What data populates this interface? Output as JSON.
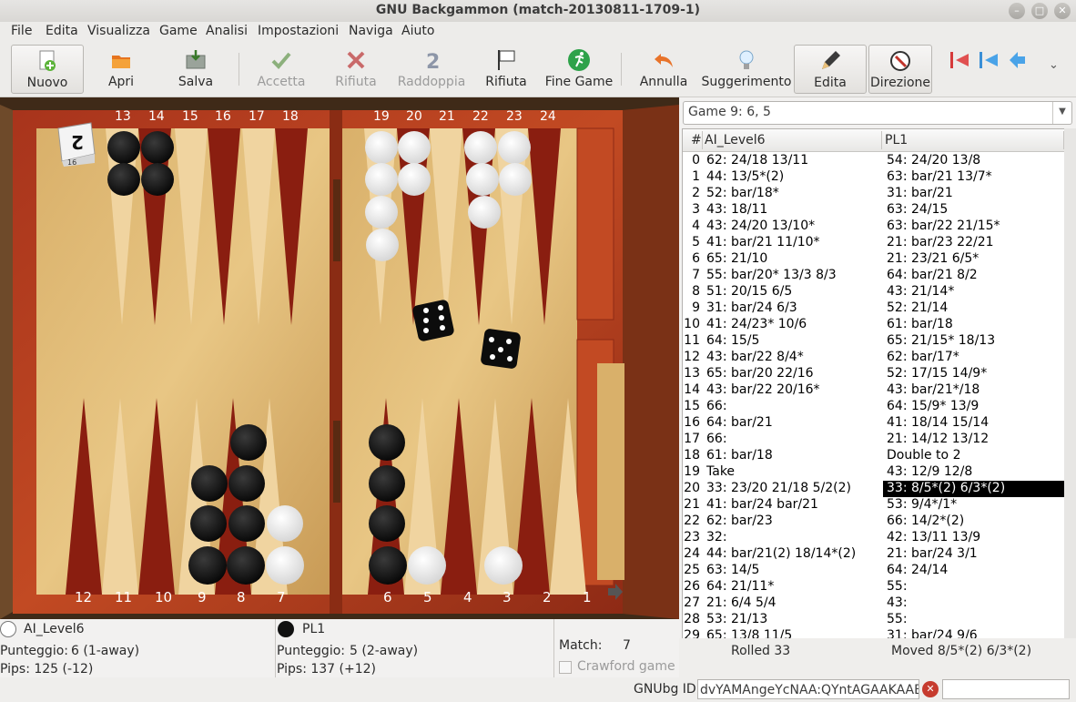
{
  "window": {
    "title": "GNU Backgammon (match-20130811-1709-1)"
  },
  "menu": [
    "File",
    "Edita",
    "Visualizza",
    "Game",
    "Analisi",
    "Impostazioni",
    "Naviga",
    "Aiuto"
  ],
  "toolbar": {
    "nuovo": "Nuovo",
    "apri": "Apri",
    "salva": "Salva",
    "accetta": "Accetta",
    "rifiuta": "Rifiuta",
    "raddoppia": "Raddoppia",
    "rifiuta2": "Rifiuta",
    "finegame": "Fine Game",
    "annulla": "Annulla",
    "suggerimento": "Suggerimento",
    "edita": "Edita",
    "direzione": "Direzione"
  },
  "board": {
    "top_numbers": [
      "13",
      "14",
      "15",
      "16",
      "17",
      "18",
      "19",
      "20",
      "21",
      "22",
      "23",
      "24"
    ],
    "bottom_numbers": [
      "12",
      "11",
      "10",
      "9",
      "8",
      "7",
      "6",
      "5",
      "4",
      "3",
      "2",
      "1"
    ],
    "cube_value": "2",
    "cube_side": "16",
    "dice": [
      6,
      5
    ]
  },
  "game_selector": "Game 9: 6, 5",
  "movelist": {
    "headers": {
      "num": "#",
      "p1": "AI_Level6",
      "p2": "PL1"
    },
    "rows": [
      {
        "n": "0",
        "a": "62: 24/18 13/11",
        "b": "54: 24/20 13/8"
      },
      {
        "n": "1",
        "a": "44: 13/5*(2)",
        "b": "63: bar/21 13/7*"
      },
      {
        "n": "2",
        "a": "52: bar/18*",
        "b": "31: bar/21"
      },
      {
        "n": "3",
        "a": "43: 18/11",
        "b": "63: 24/15"
      },
      {
        "n": "4",
        "a": "43: 24/20 13/10*",
        "b": "63: bar/22 21/15*"
      },
      {
        "n": "5",
        "a": "41: bar/21 11/10*",
        "b": "21: bar/23 22/21"
      },
      {
        "n": "6",
        "a": "65: 21/10",
        "b": "21: 23/21 6/5*"
      },
      {
        "n": "7",
        "a": "55: bar/20* 13/3 8/3",
        "b": "64: bar/21 8/2"
      },
      {
        "n": "8",
        "a": "51: 20/15 6/5",
        "b": "43: 21/14*"
      },
      {
        "n": "9",
        "a": "31: bar/24 6/3",
        "b": "52: 21/14"
      },
      {
        "n": "10",
        "a": "41: 24/23* 10/6",
        "b": "61: bar/18"
      },
      {
        "n": "11",
        "a": "64: 15/5",
        "b": "65: 21/15* 18/13"
      },
      {
        "n": "12",
        "a": "43: bar/22 8/4*",
        "b": "62: bar/17*"
      },
      {
        "n": "13",
        "a": "65: bar/20 22/16",
        "b": "52: 17/15 14/9*"
      },
      {
        "n": "14",
        "a": "43: bar/22 20/16*",
        "b": "43: bar/21*/18"
      },
      {
        "n": "15",
        "a": "66:",
        "b": "64: 15/9* 13/9"
      },
      {
        "n": "16",
        "a": "64: bar/21",
        "b": "41: 18/14 15/14"
      },
      {
        "n": "17",
        "a": "66:",
        "b": "21: 14/12 13/12"
      },
      {
        "n": "18",
        "a": "61: bar/18",
        "b": "Double to 2"
      },
      {
        "n": "19",
        "a": "Take",
        "b": "43: 12/9 12/8"
      },
      {
        "n": "20",
        "a": "33: 23/20 21/18 5/2(2)",
        "b": "33: 8/5*(2) 6/3*(2)",
        "sel": true
      },
      {
        "n": "21",
        "a": "41: bar/24 bar/21",
        "b": "53: 9/4*/1*"
      },
      {
        "n": "22",
        "a": "62: bar/23",
        "b": "66: 14/2*(2)"
      },
      {
        "n": "23",
        "a": "32:",
        "b": "42: 13/11 13/9"
      },
      {
        "n": "24",
        "a": "44: bar/21(2) 18/14*(2)",
        "b": "21: bar/24 3/1"
      },
      {
        "n": "25",
        "a": "63: 14/5",
        "b": "64: 24/14"
      },
      {
        "n": "26",
        "a": "64: 21/11*",
        "b": "55:"
      },
      {
        "n": "27",
        "a": "21: 6/4 5/4",
        "b": "43:"
      },
      {
        "n": "28",
        "a": "53: 21/13",
        "b": "55:"
      },
      {
        "n": "29",
        "a": "65: 13/8 11/5",
        "b": "31: bar/24 9/6"
      }
    ]
  },
  "player1": {
    "name": "AI_Level6",
    "score_label": "Punteggio:",
    "score": "6 (1-away)",
    "pips": "Pips: 125 (-12)"
  },
  "player2": {
    "name": "PL1",
    "score_label": "Punteggio:",
    "score": "5 (2-away)",
    "pips": "Pips: 137 (+12)"
  },
  "match": {
    "label": "Match:",
    "value": "7",
    "crawford": "Crawford game"
  },
  "status": {
    "left": "Rolled 33",
    "right": "Moved 8/5*(2) 6/3*(2)"
  },
  "gnubg": {
    "label": "GNUbg ID:",
    "value": "dvYAMAngeYcNAA:QYntAGAAKAAE"
  }
}
